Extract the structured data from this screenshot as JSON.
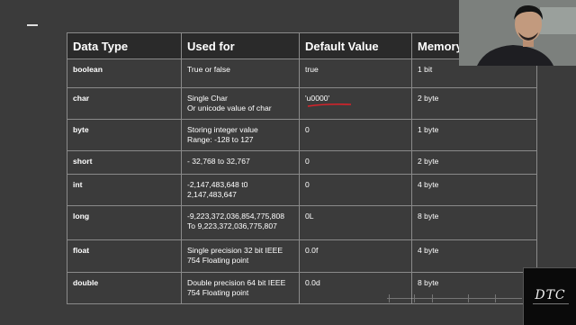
{
  "table": {
    "headers": [
      "Data Type",
      "Used for",
      "Default Value",
      "Memory"
    ],
    "rows": [
      {
        "type": "boolean",
        "used_for": [
          "True or false"
        ],
        "default": "true",
        "memory": "1 bit"
      },
      {
        "type": "char",
        "used_for": [
          "Single Char",
          "Or unicode value of char"
        ],
        "default": "'u0000'",
        "memory": "2 byte"
      },
      {
        "type": "byte",
        "used_for": [
          "Storing integer value",
          "Range: -128 to 127"
        ],
        "default": "0",
        "memory": "1 byte"
      },
      {
        "type": "short",
        "used_for": [
          "- 32,768 to 32,767"
        ],
        "default": "0",
        "memory": "2 byte"
      },
      {
        "type": "int",
        "used_for": [
          "-2,147,483,648 t0",
          "2,147,483,647"
        ],
        "default": "0",
        "memory": "4 byte"
      },
      {
        "type": "long",
        "used_for": [
          "-9,223,372,036,854,775,808",
          "To 9,223,372,036,775,807"
        ],
        "default": "0L",
        "memory": "8 byte"
      },
      {
        "type": "float",
        "used_for": [
          "Single precision 32 bit IEEE",
          "754 Floating point"
        ],
        "default": "0.0f",
        "memory": "4 byte"
      },
      {
        "type": "double",
        "used_for": [
          "Double precision 64 bit IEEE",
          "754 Floating point"
        ],
        "default": "0.0d",
        "memory": "8 byte"
      }
    ]
  },
  "annotation_color": "#d8222a",
  "logo": {
    "text": "DTC"
  }
}
